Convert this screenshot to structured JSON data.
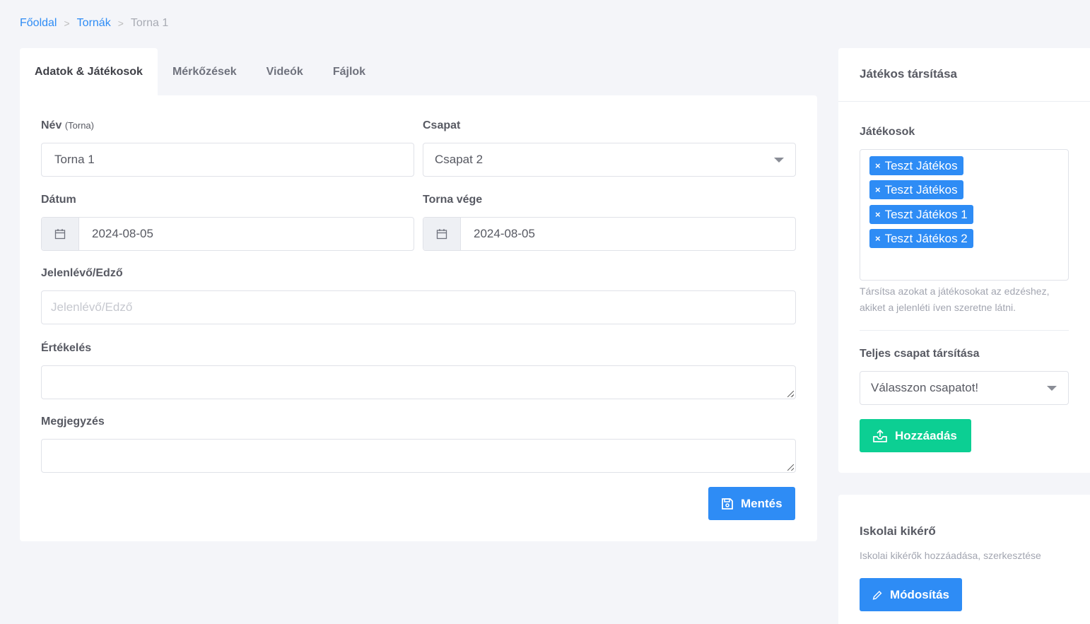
{
  "breadcrumb": {
    "home": "Főoldal",
    "list": "Tornák",
    "current": "Torna 1"
  },
  "tabs": [
    "Adatok & Játékosok",
    "Mérkőzések",
    "Videók",
    "Fájlok"
  ],
  "form": {
    "name_label": "Név",
    "name_hint": "(Torna)",
    "name_value": "Torna 1",
    "team_label": "Csapat",
    "team_value": "Csapat 2",
    "date_label": "Dátum",
    "date_value": "2024-08-05",
    "end_label": "Torna vége",
    "end_value": "2024-08-05",
    "coach_label": "Jelenlévő/Edző",
    "coach_placeholder": "Jelenlévő/Edző",
    "rating_label": "Értékelés",
    "rating_value": "",
    "note_label": "Megjegyzés",
    "note_value": "",
    "save": "Mentés"
  },
  "assign": {
    "title": "Játékos társítása",
    "players_label": "Játékosok",
    "players": [
      "Teszt Játékos",
      "Teszt Játékos",
      "Teszt Játékos 1",
      "Teszt Játékos 2"
    ],
    "remove": "×",
    "help": "Társítsa azokat a játékosokat az edzéshez, akiket a jelenléti íven szeretne látni.",
    "team_label": "Teljes csapat társítása",
    "team_placeholder": "Válasszon csapatot!",
    "add": "Hozzáadás"
  },
  "school": {
    "title": "Iskolai kikérő",
    "desc": "Iskolai kikérők hozzáadása, szerkesztése",
    "edit": "Módosítás"
  },
  "colors": {
    "primary": "#2e8cf5",
    "success": "#0ccf93"
  }
}
